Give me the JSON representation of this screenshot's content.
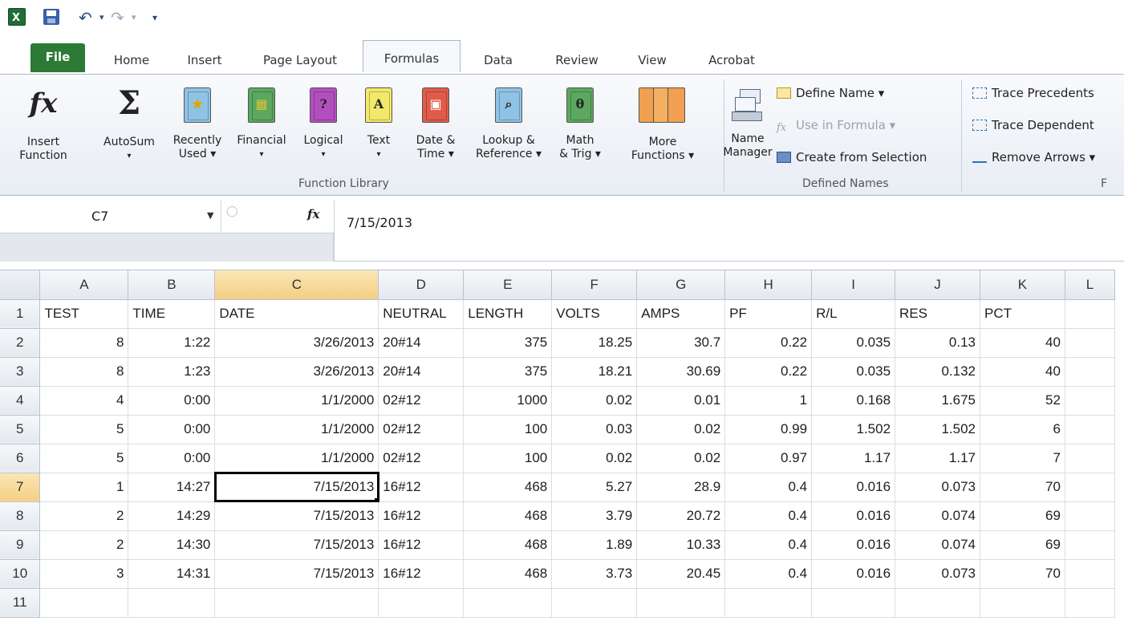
{
  "qat": {
    "undo_label": "↶",
    "redo_label": "↷",
    "customize_label": "▾"
  },
  "tabs": [
    {
      "label": "File"
    },
    {
      "label": "Home"
    },
    {
      "label": "Insert"
    },
    {
      "label": "Page Layout"
    },
    {
      "label": "Formulas"
    },
    {
      "label": "Data"
    },
    {
      "label": "Review"
    },
    {
      "label": "View"
    },
    {
      "label": "Acrobat"
    }
  ],
  "ribbon": {
    "function_library": {
      "label": "Function Library",
      "buttons": [
        {
          "line1": "Insert",
          "line2": "Function"
        },
        {
          "line1": "AutoSum",
          "line2": "▾"
        },
        {
          "line1": "Recently",
          "line2": "Used ▾"
        },
        {
          "line1": "Financial",
          "line2": "▾"
        },
        {
          "line1": "Logical",
          "line2": "▾"
        },
        {
          "line1": "Text",
          "line2": "▾"
        },
        {
          "line1": "Date &",
          "line2": "Time ▾"
        },
        {
          "line1": "Lookup &",
          "line2": "Reference ▾"
        },
        {
          "line1": "Math",
          "line2": "& Trig ▾"
        },
        {
          "line1": "More",
          "line2": "Functions ▾"
        }
      ]
    },
    "defined_names": {
      "label": "Defined Names",
      "name_manager_line1": "Name",
      "name_manager_line2": "Manager",
      "define_name": "Define Name ▾",
      "use_in_formula": "Use in Formula ▾",
      "create_from_selection": "Create from Selection"
    },
    "formula_auditing": {
      "label": "F",
      "trace_precedents": "Trace Precedents",
      "trace_dependents": "Trace Dependent",
      "remove_arrows": "Remove Arrows ▾"
    }
  },
  "formula_bar": {
    "name_box": "C7",
    "fx_label": "fx",
    "value": "7/15/2013"
  },
  "grid": {
    "columns": [
      "A",
      "B",
      "C",
      "D",
      "E",
      "F",
      "G",
      "H",
      "I",
      "J",
      "K",
      "L"
    ],
    "selected_column": "C",
    "selected_row": 7,
    "rows": [
      {
        "n": "1",
        "cells": [
          "TEST",
          "TIME",
          "DATE",
          "NEUTRAL",
          "LENGTH",
          "VOLTS",
          "AMPS",
          "PF",
          "R/L",
          "RES",
          "PCT",
          ""
        ]
      },
      {
        "n": "2",
        "cells": [
          "8",
          "1:22",
          "3/26/2013",
          "20#14",
          "375",
          "18.25",
          "30.7",
          "0.22",
          "0.035",
          "0.13",
          "40",
          ""
        ]
      },
      {
        "n": "3",
        "cells": [
          "8",
          "1:23",
          "3/26/2013",
          "20#14",
          "375",
          "18.21",
          "30.69",
          "0.22",
          "0.035",
          "0.132",
          "40",
          ""
        ]
      },
      {
        "n": "4",
        "cells": [
          "4",
          "0:00",
          "1/1/2000",
          "02#12",
          "1000",
          "0.02",
          "0.01",
          "1",
          "0.168",
          "1.675",
          "52",
          ""
        ]
      },
      {
        "n": "5",
        "cells": [
          "5",
          "0:00",
          "1/1/2000",
          "02#12",
          "100",
          "0.03",
          "0.02",
          "0.99",
          "1.502",
          "1.502",
          "6",
          ""
        ]
      },
      {
        "n": "6",
        "cells": [
          "5",
          "0:00",
          "1/1/2000",
          "02#12",
          "100",
          "0.02",
          "0.02",
          "0.97",
          "1.17",
          "1.17",
          "7",
          ""
        ]
      },
      {
        "n": "7",
        "cells": [
          "1",
          "14:27",
          "7/15/2013",
          "16#12",
          "468",
          "5.27",
          "28.9",
          "0.4",
          "0.016",
          "0.073",
          "70",
          ""
        ]
      },
      {
        "n": "8",
        "cells": [
          "2",
          "14:29",
          "7/15/2013",
          "16#12",
          "468",
          "3.79",
          "20.72",
          "0.4",
          "0.016",
          "0.074",
          "69",
          ""
        ]
      },
      {
        "n": "9",
        "cells": [
          "2",
          "14:30",
          "7/15/2013",
          "16#12",
          "468",
          "1.89",
          "10.33",
          "0.4",
          "0.016",
          "0.074",
          "69",
          ""
        ]
      },
      {
        "n": "10",
        "cells": [
          "3",
          "14:31",
          "7/15/2013",
          "16#12",
          "468",
          "3.73",
          "20.45",
          "0.4",
          "0.016",
          "0.073",
          "70",
          ""
        ]
      },
      {
        "n": "11",
        "cells": [
          "",
          "",
          "",
          "",
          "",
          "",
          "",
          "",
          "",
          "",
          "",
          ""
        ]
      }
    ]
  },
  "colors": {
    "file_tab": "#2c7a36",
    "selected_header": "#f4cf83",
    "ribbon_border": "#a9b7c9"
  }
}
